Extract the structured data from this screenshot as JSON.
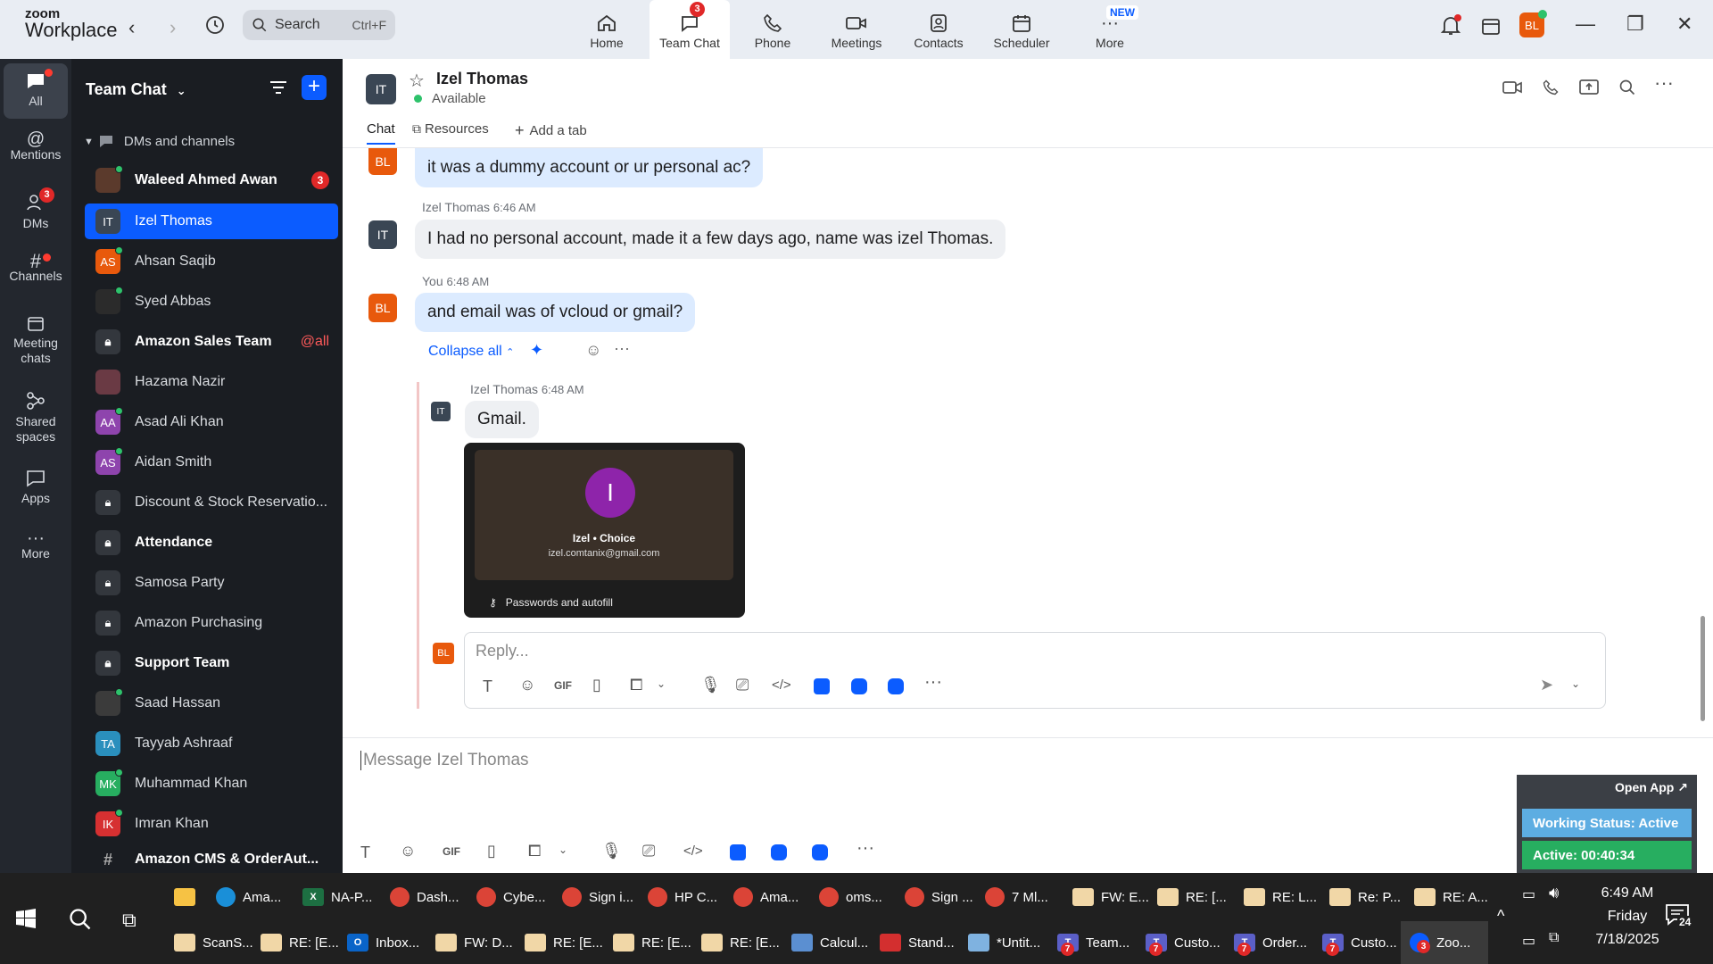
{
  "app": {
    "logo_top": "zoom",
    "logo_bottom": "Workplace"
  },
  "search": {
    "label": "Search",
    "shortcut": "Ctrl+F"
  },
  "topnav": [
    {
      "label": "Home"
    },
    {
      "label": "Team Chat",
      "badge": "3"
    },
    {
      "label": "Phone"
    },
    {
      "label": "Meetings"
    },
    {
      "label": "Contacts"
    },
    {
      "label": "Scheduler"
    },
    {
      "label": "More",
      "tag": "NEW"
    }
  ],
  "profile": {
    "initials": "BL"
  },
  "rail": [
    {
      "label": "All"
    },
    {
      "label": "Mentions"
    },
    {
      "label": "DMs",
      "badge": "3"
    },
    {
      "label": "Channels"
    },
    {
      "label": "Meeting chats"
    },
    {
      "label": "Shared spaces"
    },
    {
      "label": "Apps"
    },
    {
      "label": "More"
    }
  ],
  "sidebar": {
    "title": "Team Chat",
    "section": "DMs and channels",
    "items": [
      {
        "label": "Waleed Ahmed Awan",
        "initials": "",
        "badge": "3"
      },
      {
        "label": "Izel Thomas",
        "initials": "IT"
      },
      {
        "label": "Ahsan Saqib",
        "initials": "AS"
      },
      {
        "label": "Syed Abbas",
        "initials": ""
      },
      {
        "label": "Amazon Sales Team",
        "mention": "@all"
      },
      {
        "label": "Hazama Nazir",
        "initials": ""
      },
      {
        "label": "Asad Ali Khan",
        "initials": "AA"
      },
      {
        "label": "Aidan Smith",
        "initials": "AS"
      },
      {
        "label": "Discount & Stock Reservatio..."
      },
      {
        "label": "Attendance"
      },
      {
        "label": "Samosa Party"
      },
      {
        "label": "Amazon Purchasing"
      },
      {
        "label": "Support Team"
      },
      {
        "label": "Saad Hassan",
        "initials": ""
      },
      {
        "label": "Tayyab Ashraaf",
        "initials": "TA"
      },
      {
        "label": "Muhammad Khan",
        "initials": "MK"
      },
      {
        "label": "Imran Khan",
        "initials": "IK"
      },
      {
        "label": "Amazon CMS & OrderAut..."
      }
    ]
  },
  "chat": {
    "contact_initials": "IT",
    "contact_name": "Izel Thomas",
    "status": "Available",
    "tabs": [
      "Chat",
      "Resources",
      "Add a tab"
    ],
    "messages": [
      {
        "initials": "BL",
        "text": "it was a dummy account or ur personal ac?"
      },
      {
        "sender": "Izel Thomas",
        "time": "6:46 AM",
        "initials": "IT",
        "text": "I had no personal account, made it a few days ago, name was izel Thomas."
      },
      {
        "sender": "You",
        "time": "6:48 AM",
        "initials": "BL",
        "text": "and email was of vcloud or gmail?"
      }
    ],
    "collapse_label": "Collapse all",
    "reply": {
      "sender": "Izel Thomas",
      "time": "6:48 AM",
      "initials": "IT",
      "text": "Gmail."
    },
    "image": {
      "letter": "I",
      "name": "Izel • Choice",
      "email": "izel.comtanix@gmail.com",
      "footer": "Passwords and autofill"
    },
    "reply_placeholder": "Reply...",
    "reply_initials": "BL",
    "message_placeholder": "Message Izel Thomas"
  },
  "widget": {
    "open_app": "Open App ↗",
    "working_status": "Working Status: Active",
    "active_timer": "Active: 00:40:34"
  },
  "taskbar": {
    "row1": [
      "Ama...",
      "NA-P...",
      "Dash...",
      "Cybe...",
      "Sign i...",
      "HP C...",
      "Ama...",
      "oms...",
      "Sign ...",
      "7 Ml...",
      "FW: E...",
      "RE: [...",
      "RE: L...",
      "Re: P...",
      "RE: A..."
    ],
    "row2": [
      "ScanS...",
      "RE: [E...",
      "Inbox...",
      "FW: D...",
      "RE: [E...",
      "RE: [E...",
      "RE: [E...",
      "Calcul...",
      "Stand...",
      "*Untit...",
      "Team...",
      "Custo...",
      "Order...",
      "Custo...",
      "Zoo..."
    ],
    "time": "6:49 AM",
    "day": "Friday",
    "date": "7/18/2025",
    "notif_count": "24",
    "task_badge": "7",
    "zoom_badge": "3"
  },
  "colors": {
    "accent": "#0b5cff",
    "avatar_orange": "#e8590c",
    "avatar_purple": "#8e44ad",
    "online": "#2ec26b",
    "widget_green": "#27ae60"
  }
}
